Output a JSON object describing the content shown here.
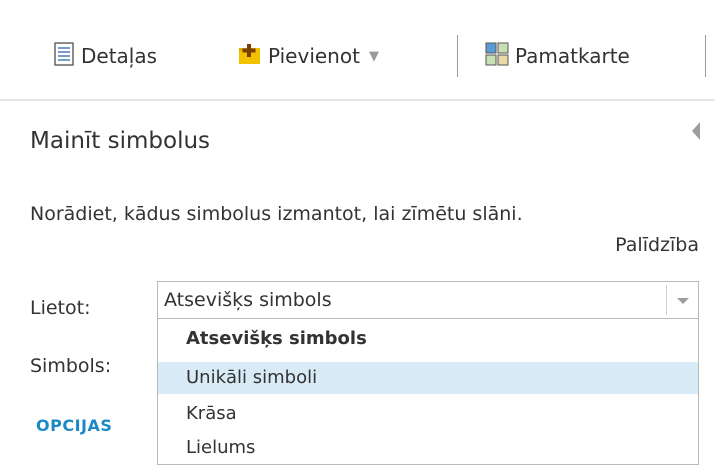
{
  "toolbar": {
    "details_label": "Detaļas",
    "details_icon": "details-icon",
    "add_label": "Pievienot",
    "add_icon": "add-plus-icon",
    "basemap_label": "Pamatkarte",
    "basemap_icon": "basemap-grid-icon"
  },
  "panel": {
    "title": "Mainīt simbolus",
    "description": "Norādiet, kādus simbolus izmantot, lai zīmētu slāni.",
    "help_link": "Palīdzība",
    "use_label": "Lietot:",
    "symbol_label": "Simbols:",
    "options_link": "OPCIJAS"
  },
  "select": {
    "value": "Atsevišķs simbols",
    "options": [
      {
        "label": "Atsevišķs simbols",
        "selected": true
      },
      {
        "label": "Unikāli simboli",
        "highlighted": true
      },
      {
        "label": "Krāsa"
      },
      {
        "label": "Lielums"
      }
    ]
  },
  "colors": {
    "accent": "#1e88c7",
    "highlight": "#d9ebf7",
    "icon_yellow": "#f2c200"
  }
}
